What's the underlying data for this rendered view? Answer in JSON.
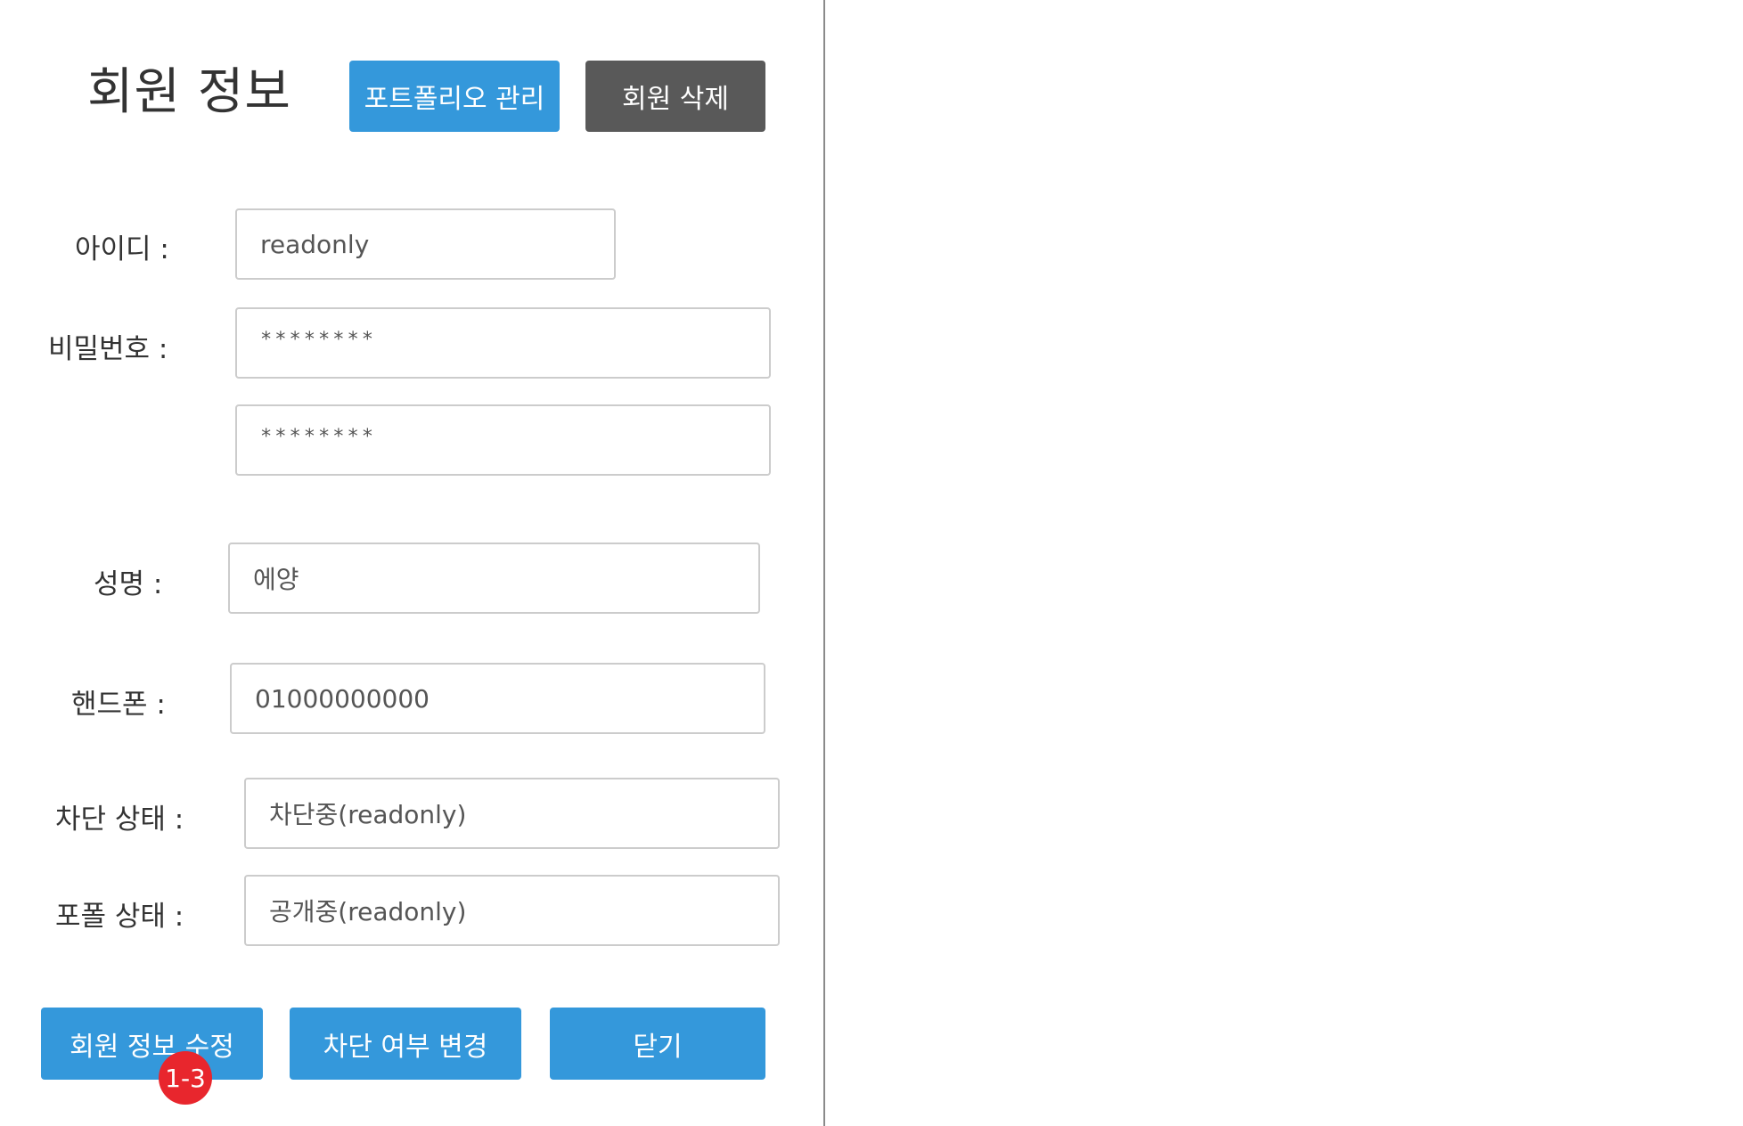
{
  "header": {
    "title": "회원 정보",
    "portfolio_button": "포트폴리오 관리",
    "delete_button": "회원 삭제"
  },
  "form": {
    "id": {
      "label": "아이디 :",
      "value": "readonly"
    },
    "password": {
      "label": "비밀번호 :",
      "value": "********",
      "confirm_value": "********"
    },
    "name": {
      "label": "성명 :",
      "value": "에양"
    },
    "phone": {
      "label": "핸드폰 :",
      "value": "01000000000"
    },
    "block_status": {
      "label": "차단 상태 :",
      "value": "차단중(readonly)"
    },
    "portfolio_status": {
      "label": "포폴 상태 :",
      "value": "공개중(readonly)"
    }
  },
  "actions": {
    "edit_button": "회원 정보 수정",
    "toggle_block_button": "차단 여부 변경",
    "close_button": "닫기"
  },
  "annotation": {
    "badge": "1-3",
    "badge_color": "#e8262d"
  },
  "colors": {
    "primary": "#3498db",
    "secondary": "#595959",
    "divider": "#8a8a8a"
  }
}
